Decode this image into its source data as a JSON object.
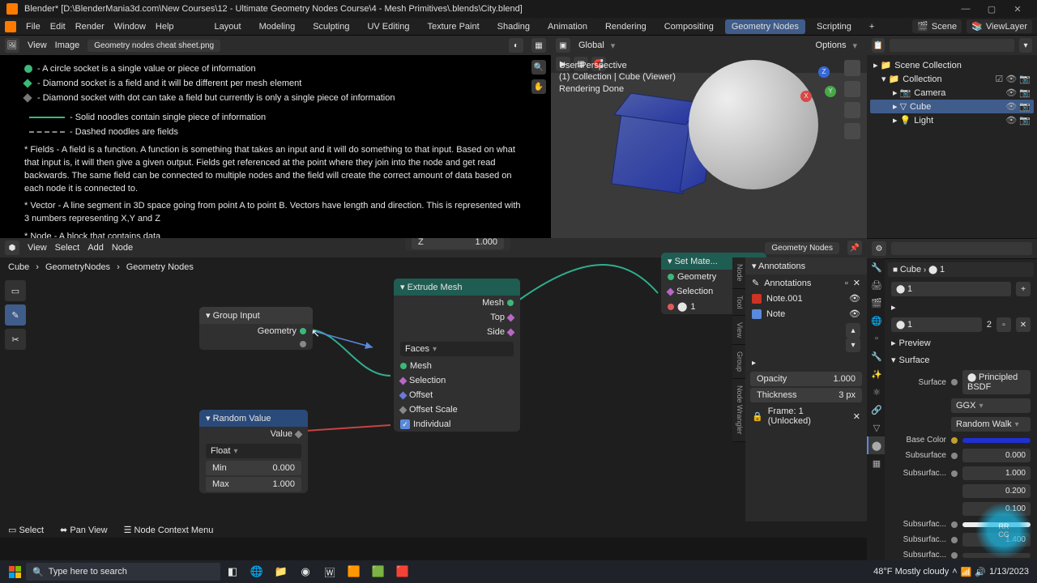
{
  "window": {
    "title": "Blender* [D:\\BlenderMania3d.com\\New Courses\\12 - Ultimate Geometry Nodes Course\\4 - Mesh Primitives\\.blends\\City.blend]"
  },
  "menu": {
    "file": "File",
    "edit": "Edit",
    "render": "Render",
    "window": "Window",
    "help": "Help"
  },
  "workspaces": [
    "Layout",
    "Modeling",
    "Sculpting",
    "UV Editing",
    "Texture Paint",
    "Shading",
    "Animation",
    "Rendering",
    "Compositing",
    "Geometry Nodes",
    "Scripting"
  ],
  "workspaces_active": 9,
  "top_right": {
    "scene": "Scene",
    "viewlayer": "ViewLayer"
  },
  "image_editor": {
    "menu": {
      "view": "View",
      "image": "Image"
    },
    "image_name": "Geometry nodes cheat sheet.png",
    "notes": {
      "circle": "- A circle socket is a single value or piece of information",
      "diamond": "- Diamond socket is a field and it will be different per mesh element",
      "diamond_dot": "- Diamond socket with dot can take a field but currently is only a single piece of information",
      "solid": "- Solid noodles contain single piece of information",
      "dashed": "- Dashed noodles are fields",
      "fields": "* Fields - A field is a function. A function is something that takes an input and it will do something to that input. Based on what that input is, it will then give a given output. Fields get referenced at the point where they join into the node and get read backwards. The same field can be connected to multiple nodes and the field will create the correct amount of data based on each node it is connected to.",
      "vector": "* Vector - A line segment in 3D space going from point A to point B. Vectors have length and direction. This is represented with 3 numbers representing X,Y and Z",
      "node": "* Node - A block that contains data"
    }
  },
  "viewport": {
    "header": {
      "global": "Global",
      "options": "Options"
    },
    "overlay": {
      "persp": "User Perspective",
      "coll": "(1) Collection | Cube (Viewer)",
      "render": "Rendering Done"
    }
  },
  "outliner": {
    "root": "Scene Collection",
    "coll": "Collection",
    "camera": "Camera",
    "cube": "Cube",
    "light": "Light"
  },
  "properties": {
    "object": "Cube",
    "slot_count": "1",
    "slot_field": "1",
    "material": "1",
    "preview": "Preview",
    "surface": "Surface",
    "surface_label": "Surface",
    "bsdf": "Principled BSDF",
    "dist": "GGX",
    "sss_method": "Random Walk",
    "basecolor_label": "Base Color",
    "subsurface_label": "Subsurface",
    "subsurface_val": "0.000",
    "subsurfac1_label": "Subsurfac...",
    "subsurfac1_v1": "1.000",
    "subsurfac1_v2": "0.200",
    "subsurfac1_v3": "0.100",
    "subsurfac2_label": "Subsurfac...",
    "subsurfac3_label": "Subsurfac...",
    "subsurfac3_val": "1.400",
    "subsurfac4_label": "Subsurfac...",
    "users": "2"
  },
  "node_editor": {
    "menu": {
      "view": "View",
      "select": "Select",
      "add": "Add",
      "node": "Node"
    },
    "name": "Geometry Nodes",
    "crumbs": {
      "obj": "Cube",
      "mod": "GeometryNodes",
      "grp": "Geometry Nodes"
    },
    "z_label": "Z",
    "z_val": "1.000",
    "group_input": {
      "title": "Group Input",
      "geometry": "Geometry"
    },
    "random_value": {
      "title": "Random Value",
      "value": "Value",
      "type": "Float",
      "min_label": "Min",
      "min": "0.000",
      "max_label": "Max",
      "max": "1.000"
    },
    "extrude": {
      "title": "Extrude Mesh",
      "mesh_out": "Mesh",
      "top": "Top",
      "side": "Side",
      "mode": "Faces",
      "mesh_in": "Mesh",
      "selection": "Selection",
      "offset": "Offset",
      "offset_scale": "Offset Scale",
      "individual": "Individual"
    },
    "set_mat": {
      "title": "Set Mate...",
      "geometry": "Geometry",
      "selection": "Selection",
      "material": "1"
    },
    "npanel": {
      "annotations": "Annotations",
      "layer": "Annotations",
      "note1": "Note.001",
      "note2": "Note",
      "opacity_label": "Opacity",
      "opacity": "1.000",
      "thickness_label": "Thickness",
      "thickness": "3 px",
      "frame": "Frame: 1 (Unlocked)"
    },
    "vtabs": [
      "Node",
      "Tool",
      "View",
      "Group",
      "Node Wrangler"
    ]
  },
  "statusbar": {
    "select": "Select",
    "pan": "Pan View",
    "ctx": "Node Context Menu"
  },
  "taskbar": {
    "search_placeholder": "Type here to search",
    "weather": "48°F  Mostly cloudy",
    "time": "1/13/2023"
  }
}
